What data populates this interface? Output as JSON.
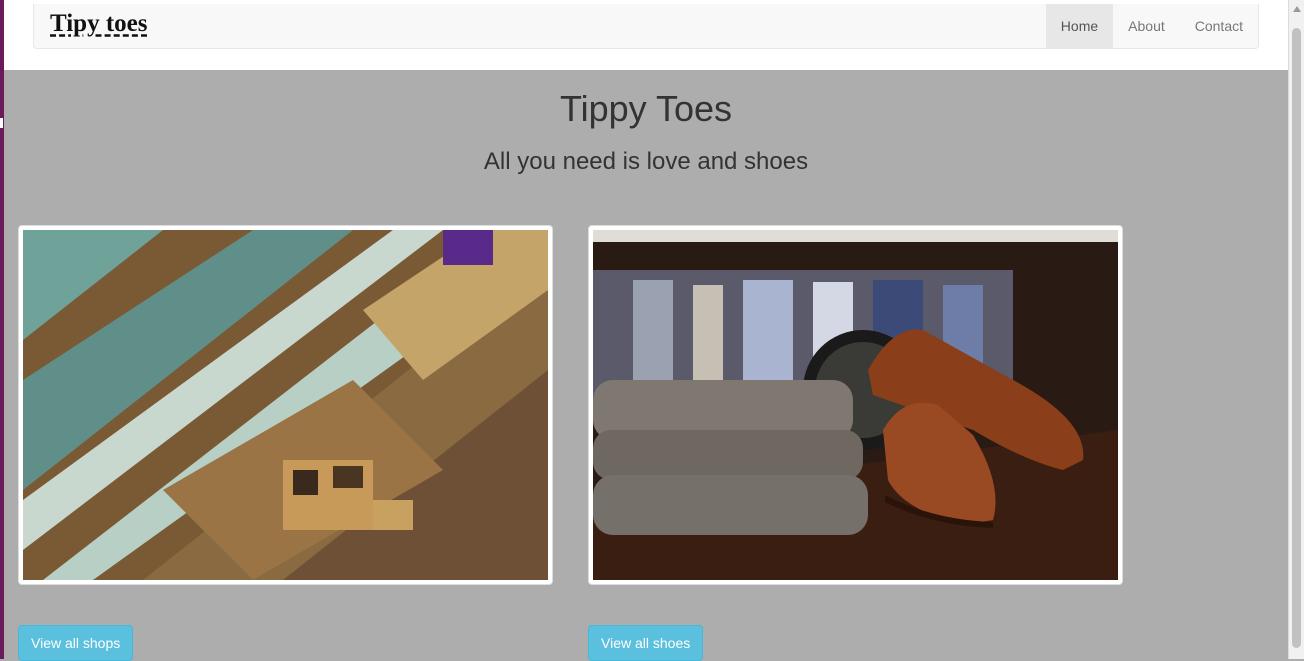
{
  "brand": {
    "name": "Tipy toes"
  },
  "nav": {
    "items": [
      {
        "label": "Home",
        "active": true
      },
      {
        "label": "About",
        "active": false
      },
      {
        "label": "Contact",
        "active": false
      }
    ]
  },
  "hero": {
    "title": "Tippy Toes",
    "subtitle": "All you need is love and shoes"
  },
  "cards": [
    {
      "image": "mall-escalators-photo",
      "button_label": "View all shops"
    },
    {
      "image": "brown-brogue-shoes-photo",
      "button_label": "View all shoes"
    }
  ],
  "colors": {
    "button": "#5bc0de",
    "page_bg": "#adadad",
    "navbar_bg": "#f8f8f8"
  }
}
